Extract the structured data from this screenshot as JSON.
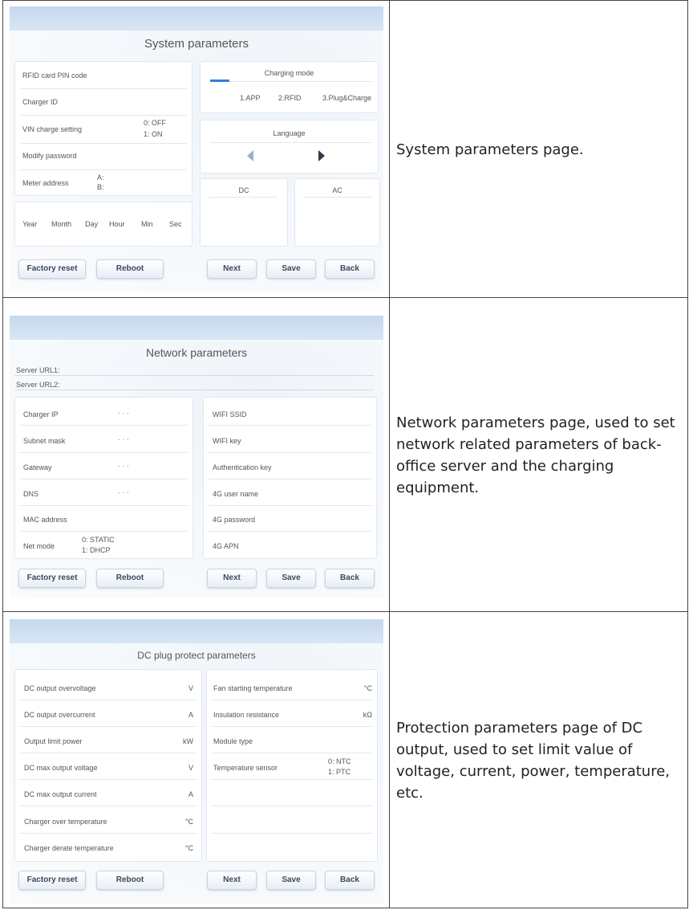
{
  "common": {
    "factory_reset": "Factory reset",
    "reboot": "Reboot",
    "next": "Next",
    "save": "Save",
    "back": "Back"
  },
  "system": {
    "title": "System parameters",
    "left_rows": [
      "RFID card PIN code",
      "Charger ID",
      "VIN charge setting",
      "Modify password",
      "Meter address"
    ],
    "vin_options": [
      "0: OFF",
      "1: ON"
    ],
    "meter_options": [
      "A:",
      "B:"
    ],
    "datetime": [
      "Year",
      "Month",
      "Day",
      "Hour",
      "Min",
      "Sec"
    ],
    "charging_mode_title": "Charging mode",
    "charging_modes": [
      "1.APP",
      "2.RFID",
      "3.Plug&Charge"
    ],
    "language_title": "Language",
    "dc_label": "DC",
    "ac_label": "AC",
    "description": "System parameters page."
  },
  "network": {
    "title": "Network parameters",
    "server_url1": "Server URL1:",
    "server_url2": "Server URL2:",
    "left_rows": [
      "Charger IP",
      "Subnet mask",
      "Gateway",
      "DNS",
      "MAC address",
      "Net mode"
    ],
    "ip_dots": "·      ·      ·",
    "net_mode_options": [
      "0: STATIC",
      "1: DHCP"
    ],
    "right_rows": [
      "WIFI SSID",
      "WIFI key",
      "Authentication key",
      "4G user name",
      "4G password",
      "4G APN"
    ],
    "description": "Network parameters page, used to set network related parameters of back-office server and the charging equipment."
  },
  "dc_protect": {
    "title": "DC plug protect parameters",
    "left_rows": [
      {
        "label": "DC output overvoltage",
        "unit": "V"
      },
      {
        "label": "DC output overcurrent",
        "unit": "A"
      },
      {
        "label": "Output limit power",
        "unit": "kW"
      },
      {
        "label": "DC max output voltage",
        "unit": "V"
      },
      {
        "label": "DC max output current",
        "unit": "A"
      },
      {
        "label": "Charger over temperature",
        "unit": "°C"
      },
      {
        "label": "Charger derate temperature",
        "unit": "°C"
      }
    ],
    "right_rows": [
      {
        "label": "Fan starting temperature",
        "unit": "°C"
      },
      {
        "label": "Insulation resistance",
        "unit": "kΩ"
      },
      {
        "label": "Module type",
        "unit": ""
      },
      {
        "label": "Temperature sensor",
        "unit": ""
      }
    ],
    "sensor_options": [
      "0: NTC",
      "1: PTC"
    ],
    "description": "Protection parameters page of DC output, used to set limit value of voltage, current, power, temperature, etc."
  }
}
